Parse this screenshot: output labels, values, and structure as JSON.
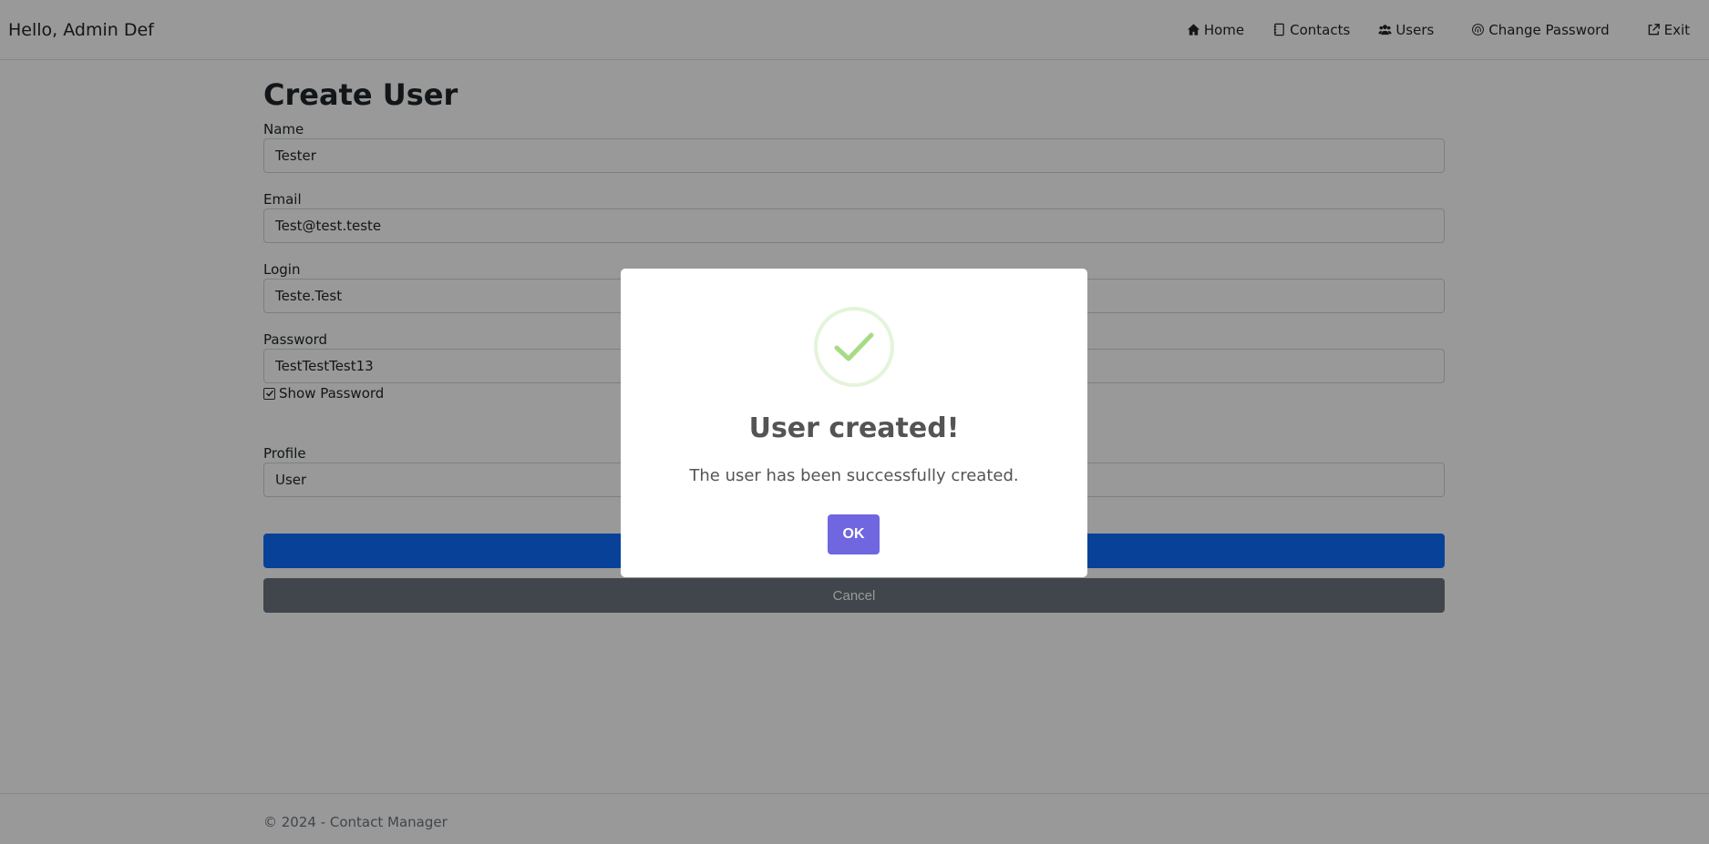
{
  "header": {
    "greeting": "Hello, Admin Def",
    "nav": [
      {
        "label": "Home",
        "icon": "home-icon"
      },
      {
        "label": "Contacts",
        "icon": "contacts-book-icon"
      },
      {
        "label": "Users",
        "icon": "users-icon"
      },
      {
        "label": "Change Password",
        "icon": "fingerprint-icon"
      },
      {
        "label": "Exit",
        "icon": "external-link-icon"
      }
    ]
  },
  "form": {
    "title": "Create User",
    "name_label": "Name",
    "name_value": "Tester",
    "email_label": "Email",
    "email_value": "Test@test.teste",
    "login_label": "Login",
    "login_value": "Teste.Test",
    "password_label": "Password",
    "password_value": "TestTestTest13",
    "show_password_label": "Show Password",
    "show_password_checked": true,
    "profile_label": "Profile",
    "profile_value": "User",
    "submit_label": "",
    "cancel_label": "Cancel"
  },
  "footer": {
    "text": "© 2024 - Contact Manager"
  },
  "modal": {
    "title": "User created!",
    "message": "The user has been successfully created.",
    "ok_label": "OK",
    "icon": "success-check-icon"
  },
  "colors": {
    "primary": "#0d6efd",
    "secondary": "#6c757d",
    "confirm": "#7066e0",
    "success": "#a5dc86"
  }
}
